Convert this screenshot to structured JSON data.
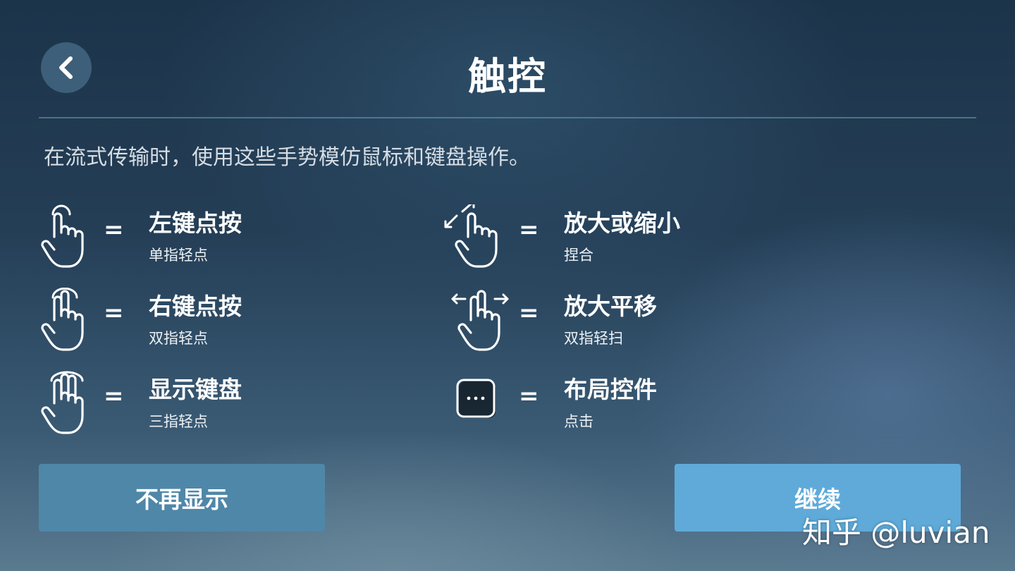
{
  "header": {
    "title": "触控",
    "back_icon": "chevron-left-icon"
  },
  "description": "在流式传输时，使用这些手势模仿鼠标和键盘操作。",
  "equals_sign": "=",
  "gestures_left": [
    {
      "icon": "one-finger-tap-icon",
      "label": "左键点按",
      "sub": "单指轻点"
    },
    {
      "icon": "two-finger-tap-icon",
      "label": "右键点按",
      "sub": "双指轻点"
    },
    {
      "icon": "three-finger-tap-icon",
      "label": "显示键盘",
      "sub": "三指轻点"
    }
  ],
  "gestures_right": [
    {
      "icon": "pinch-zoom-icon",
      "label": "放大或缩小",
      "sub": "捏合"
    },
    {
      "icon": "two-finger-pan-icon",
      "label": "放大平移",
      "sub": "双指轻扫"
    },
    {
      "icon": "more-dots-icon",
      "label": "布局控件",
      "sub": "点击"
    }
  ],
  "buttons": {
    "hide_label": "不再显示",
    "continue_label": "继续"
  },
  "watermark": "知乎 @luvian",
  "colors": {
    "hide_button": "#4f87a8",
    "continue_button": "#5faad9",
    "back_button": "#3d5f7a"
  }
}
